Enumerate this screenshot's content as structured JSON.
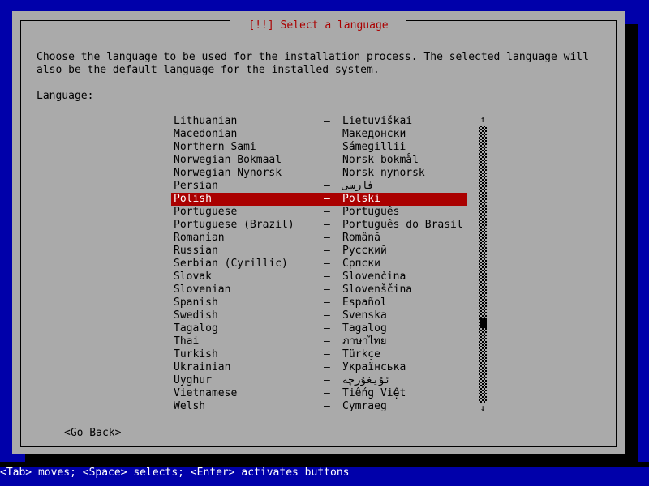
{
  "screen": {
    "background_color": "#0000aa",
    "dialog_bg": "#aaaaaa",
    "text_color": "#000000",
    "title_color": "#aa0000",
    "highlight_bg": "#aa0000",
    "highlight_fg": "#ffffff",
    "status_fg": "#ffffff"
  },
  "dialog": {
    "title": "[!!] Select a language",
    "title_bracket_left": "",
    "title_bracket_right": "",
    "intro_line1": "Choose the language to be used for the installation process. The selected language will",
    "intro_line2": "also be the default language for the installed system.",
    "field_label": "Language:",
    "go_back_label": "<Go Back>"
  },
  "scrollbar": {
    "up_arrow": "↑",
    "down_arrow": "↓",
    "thumb_position_percent": 72
  },
  "statusbar": {
    "text": "<Tab> moves; <Space> selects; <Enter> activates buttons"
  },
  "list": {
    "dash": "–",
    "selected_index": 6,
    "items": [
      {
        "english": "Lithuanian",
        "native": "Lietuviškai",
        "rtl": false
      },
      {
        "english": "Macedonian",
        "native": "Македонски",
        "rtl": false
      },
      {
        "english": "Northern Sami",
        "native": "Sámegillii",
        "rtl": false
      },
      {
        "english": "Norwegian Bokmaal",
        "native": "Norsk bokmål",
        "rtl": false
      },
      {
        "english": "Norwegian Nynorsk",
        "native": "Norsk nynorsk",
        "rtl": false
      },
      {
        "english": "Persian",
        "native": "فارسی",
        "rtl": true
      },
      {
        "english": "Polish",
        "native": "Polski",
        "rtl": false
      },
      {
        "english": "Portuguese",
        "native": "Português",
        "rtl": false
      },
      {
        "english": "Portuguese (Brazil)",
        "native": "Português do Brasil",
        "rtl": false
      },
      {
        "english": "Romanian",
        "native": "Română",
        "rtl": false
      },
      {
        "english": "Russian",
        "native": "Русский",
        "rtl": false
      },
      {
        "english": "Serbian (Cyrillic)",
        "native": "Српски",
        "rtl": false
      },
      {
        "english": "Slovak",
        "native": "Slovenčina",
        "rtl": false
      },
      {
        "english": "Slovenian",
        "native": "Slovenščina",
        "rtl": false
      },
      {
        "english": "Spanish",
        "native": "Español",
        "rtl": false
      },
      {
        "english": "Swedish",
        "native": "Svenska",
        "rtl": false
      },
      {
        "english": "Tagalog",
        "native": "Tagalog",
        "rtl": false
      },
      {
        "english": "Thai",
        "native": "ภาษาไทย",
        "rtl": false
      },
      {
        "english": "Turkish",
        "native": "Türkçe",
        "rtl": false
      },
      {
        "english": "Ukrainian",
        "native": "Українська",
        "rtl": false
      },
      {
        "english": "Uyghur",
        "native": "ئۇيغۇرچە",
        "rtl": true
      },
      {
        "english": "Vietnamese",
        "native": "Tiếng Việt",
        "rtl": false
      },
      {
        "english": "Welsh",
        "native": "Cymraeg",
        "rtl": false
      }
    ]
  }
}
